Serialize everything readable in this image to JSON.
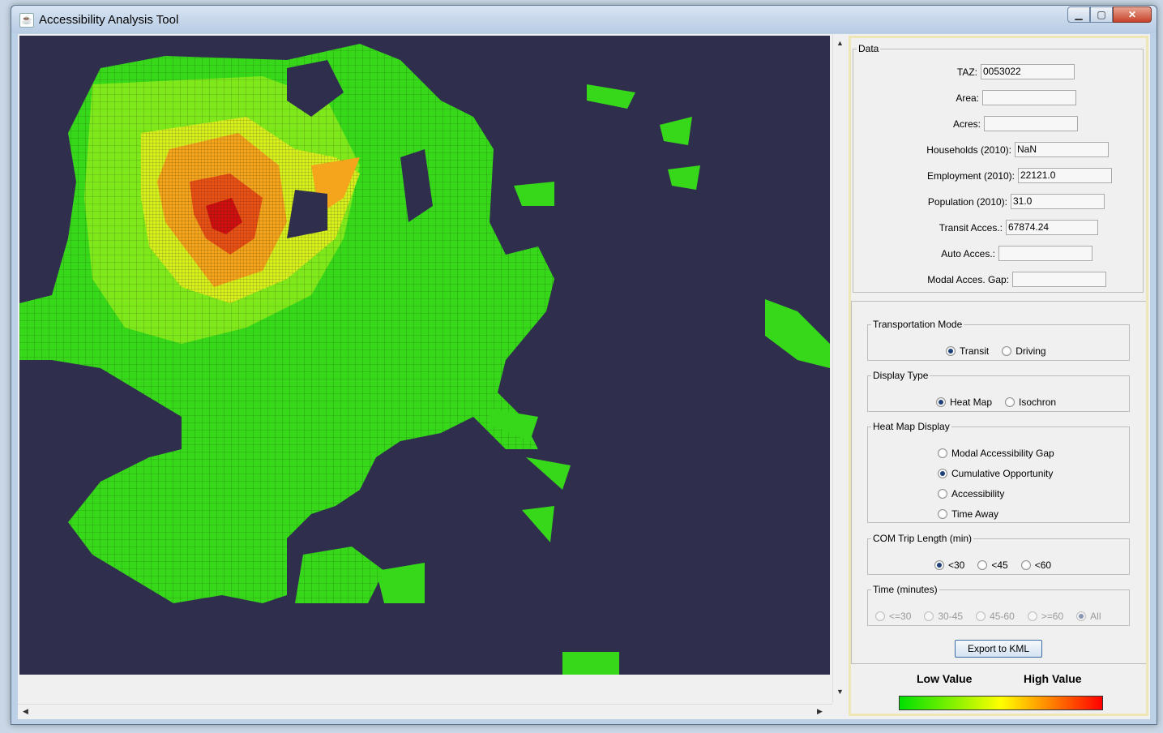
{
  "window": {
    "title": "Accessibility Analysis Tool",
    "icon": "java-icon"
  },
  "data_panel": {
    "legend": "Data",
    "fields": [
      {
        "label": "TAZ:",
        "value": "0053022"
      },
      {
        "label": "Area:",
        "value": ""
      },
      {
        "label": "Acres:",
        "value": ""
      },
      {
        "label": "Households (2010):",
        "value": "NaN"
      },
      {
        "label": "Employment (2010):",
        "value": "22121.0"
      },
      {
        "label": "Population (2010):",
        "value": "31.0"
      },
      {
        "label": "Transit Acces.:",
        "value": "67874.24"
      },
      {
        "label": "Auto Acces.:",
        "value": ""
      },
      {
        "label": "Modal Acces. Gap:",
        "value": ""
      }
    ]
  },
  "transportation_mode": {
    "legend": "Transportation Mode",
    "options": [
      "Transit",
      "Driving"
    ],
    "selected": "Transit"
  },
  "display_type": {
    "legend": "Display Type",
    "options": [
      "Heat Map",
      "Isochron"
    ],
    "selected": "Heat Map"
  },
  "heat_map_display": {
    "legend": "Heat Map Display",
    "options": [
      "Modal Accessibility Gap",
      "Cumulative Opportunity",
      "Accessibility",
      "Time Away"
    ],
    "selected": "Cumulative Opportunity"
  },
  "com_trip_length": {
    "legend": "COM Trip Length (min)",
    "options": [
      "<30",
      "<45",
      "<60"
    ],
    "selected": "<30"
  },
  "time_minutes": {
    "legend": "Time (minutes)",
    "options": [
      "<=30",
      "30-45",
      "45-60",
      ">=60",
      "All"
    ],
    "selected": "All",
    "disabled": true
  },
  "export_button": "Export to KML",
  "color_legend": {
    "low": "Low Value",
    "high": "High Value",
    "colors": [
      "#00e000",
      "#7df000",
      "#ffff00",
      "#ff8000",
      "#ff0000"
    ]
  },
  "map": {
    "background": "#2f2f4d"
  }
}
